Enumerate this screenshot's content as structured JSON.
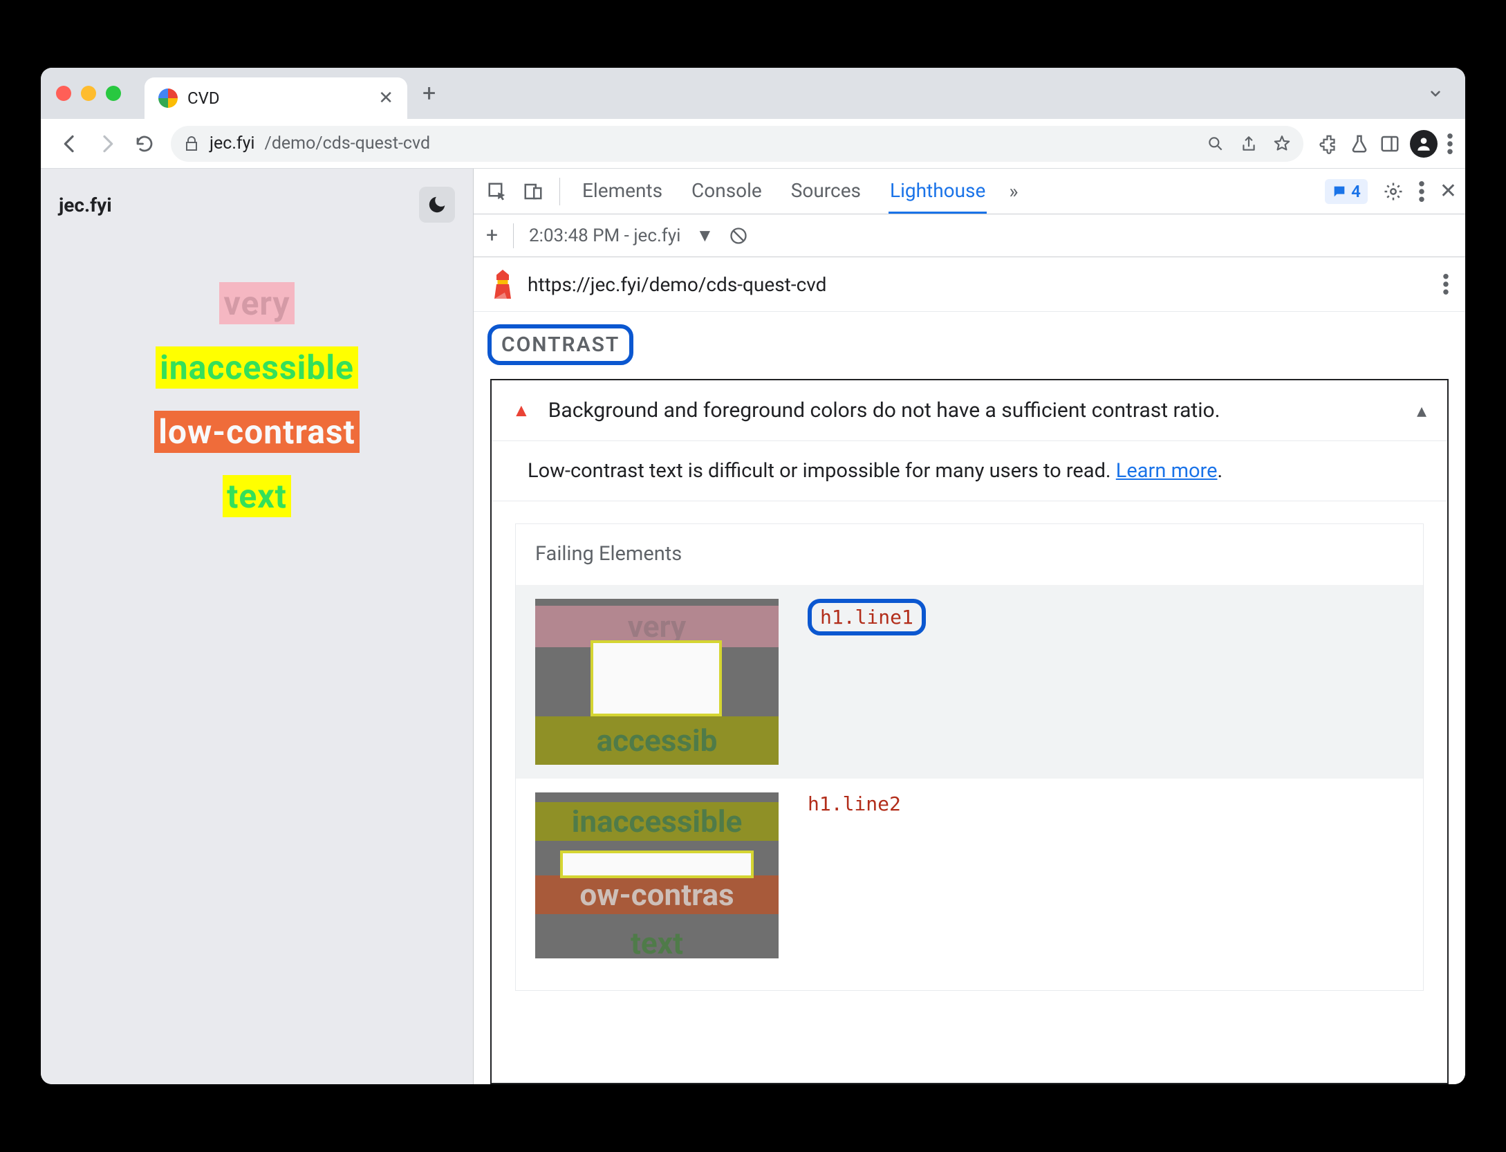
{
  "browser": {
    "tab_title": "CVD",
    "url_host": "jec.fyi",
    "url_path": "/demo/cds-quest-cvd"
  },
  "page": {
    "site_title": "jec.fyi",
    "words": [
      "very",
      "inaccessible",
      "low-contrast",
      "text"
    ]
  },
  "devtools": {
    "panels": [
      "Elements",
      "Console",
      "Sources",
      "Lighthouse"
    ],
    "active_panel": "Lighthouse",
    "messages_count": "4",
    "report_label": "2:03:48 PM - jec.fyi",
    "report_url": "https://jec.fyi/demo/cds-quest-cvd",
    "section_heading": "CONTRAST",
    "audit_title": "Background and foreground colors do not have a sufficient contrast ratio.",
    "audit_desc_prefix": "Low-contrast text is difficult or impossible for many users to read. ",
    "audit_learn_more": "Learn more",
    "audit_desc_suffix": ".",
    "failing_heading": "Failing Elements",
    "failing": [
      {
        "selector": "h1.line1"
      },
      {
        "selector": "h1.line2"
      }
    ]
  }
}
